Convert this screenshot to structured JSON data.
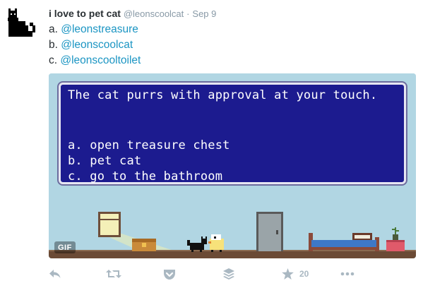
{
  "tweet": {
    "display_name": "i love to pet cat",
    "handle": "@leonscoolcat",
    "separator": "·",
    "timestamp": "Sep 9",
    "lines": [
      {
        "prefix": "a. ",
        "mention": "@leonstreasure"
      },
      {
        "prefix": "b. ",
        "mention": "@leonscoolcat"
      },
      {
        "prefix": "c. ",
        "mention": "@leonscooltoilet"
      }
    ]
  },
  "media": {
    "dialog_message": "The cat purrs with approval at your touch.",
    "dialog_options": [
      "a. open treasure chest",
      "b. pet cat",
      "c. go to the bathroom"
    ],
    "badge": "GIF"
  },
  "actions": {
    "reply": {
      "icon": "reply-icon"
    },
    "retweet": {
      "icon": "retweet-icon"
    },
    "pocket": {
      "icon": "pocket-icon"
    },
    "buffer": {
      "icon": "buffer-icon"
    },
    "favorite": {
      "icon": "star-icon",
      "count": "20"
    },
    "more": {
      "icon": "more-dots-icon"
    }
  },
  "colors": {
    "link": "#1b95c3",
    "muted": "#8899a6",
    "action_icon": "#aab8c2",
    "dialog_bg": "#1c1b8f",
    "scene_wall": "#b1d6e3",
    "scene_floor": "#6b4a35"
  }
}
